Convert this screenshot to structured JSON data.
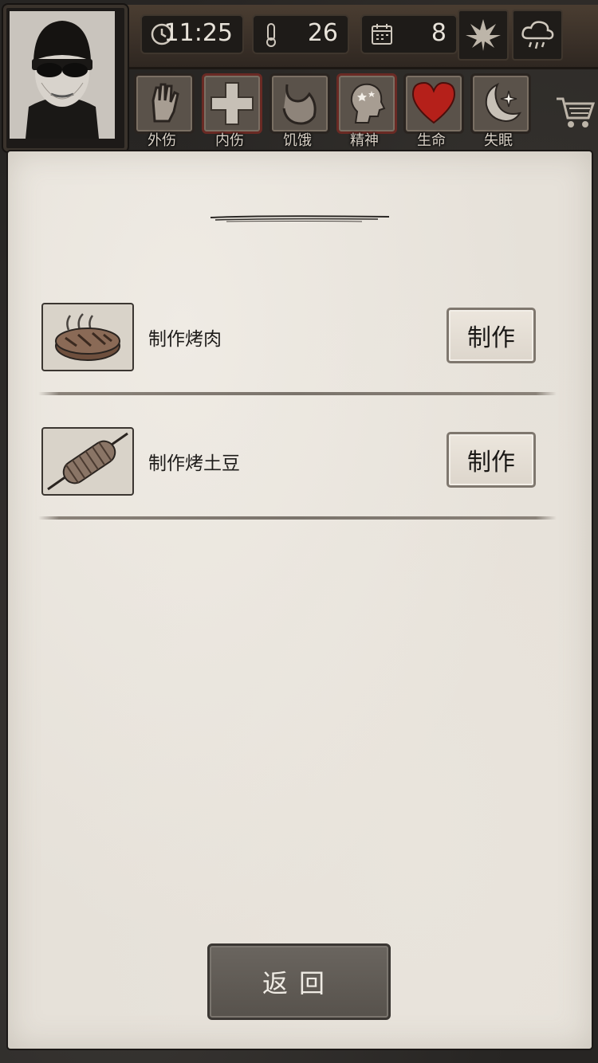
{
  "hud": {
    "time": "11:25",
    "temperature": "26",
    "day": "8",
    "season_icon": "leaf-icon",
    "weather_icon": "rain-cloud-icon"
  },
  "status_icons": [
    {
      "icon": "hand-icon",
      "label": "外伤"
    },
    {
      "icon": "cross-icon",
      "label": "内伤"
    },
    {
      "icon": "stomach-icon",
      "label": "饥饿"
    },
    {
      "icon": "head-icon",
      "label": "精神"
    },
    {
      "icon": "heart-icon",
      "label": "生命"
    },
    {
      "icon": "moon-star-icon",
      "label": "失眠"
    }
  ],
  "colors": {
    "heart": "#b5201a",
    "paper": "#e6e1d9",
    "wood": "#3a3028"
  },
  "recipes": [
    {
      "name": "制作烤肉",
      "icon": "grilled-meat-icon",
      "button": "制作"
    },
    {
      "name": "制作烤土豆",
      "icon": "roasted-potato-icon",
      "button": "制作"
    }
  ],
  "back_button": "返回"
}
